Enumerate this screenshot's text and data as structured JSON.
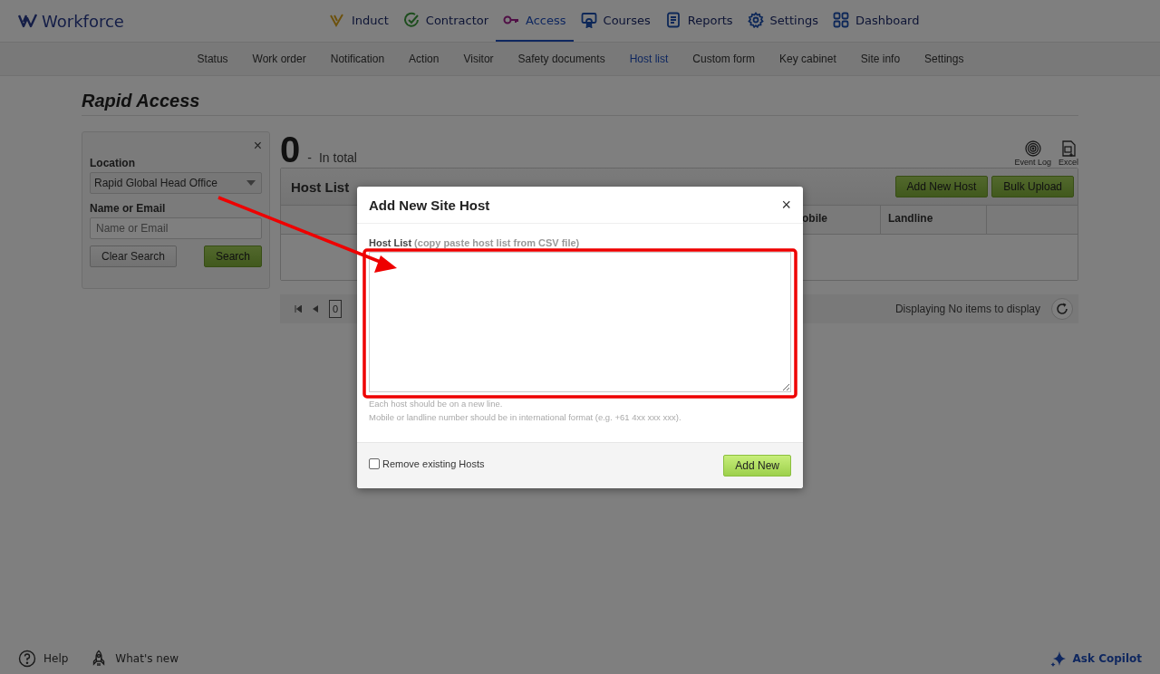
{
  "brand": "Workforce",
  "nav": [
    {
      "label": "Induct",
      "selected": false
    },
    {
      "label": "Contractor",
      "selected": false
    },
    {
      "label": "Access",
      "selected": true
    },
    {
      "label": "Courses",
      "selected": false
    },
    {
      "label": "Reports",
      "selected": false
    },
    {
      "label": "Settings",
      "selected": false
    },
    {
      "label": "Dashboard",
      "selected": false
    }
  ],
  "subnav": [
    {
      "label": "Status",
      "selected": false
    },
    {
      "label": "Work order",
      "selected": false
    },
    {
      "label": "Notification",
      "selected": false
    },
    {
      "label": "Action",
      "selected": false
    },
    {
      "label": "Visitor",
      "selected": false
    },
    {
      "label": "Safety documents",
      "selected": false
    },
    {
      "label": "Host list",
      "selected": true
    },
    {
      "label": "Custom form",
      "selected": false
    },
    {
      "label": "Key cabinet",
      "selected": false
    },
    {
      "label": "Site info",
      "selected": false
    },
    {
      "label": "Settings",
      "selected": false
    }
  ],
  "page_title": "Rapid Access",
  "filter": {
    "close": "×",
    "location_label": "Location",
    "location_value": "Rapid Global Head Office",
    "name_label": "Name or Email",
    "name_placeholder": "Name or Email",
    "clear_button": "Clear Search",
    "search_button": "Search"
  },
  "summary": {
    "count": "0",
    "dash": "-",
    "label": "In total"
  },
  "tools": [
    {
      "label": "Event Log"
    },
    {
      "label": "Excel"
    }
  ],
  "host_list": {
    "title": "Host List",
    "buttons": [
      "Add New Host",
      "Bulk Upload"
    ],
    "columns": [
      "obile",
      "Landline"
    ]
  },
  "pager": {
    "page": "0",
    "status": "Displaying No items to display"
  },
  "modal": {
    "title": "Add New Site Host",
    "close": "×",
    "field_label": "Host List",
    "field_hint": "(copy paste host list from CSV file)",
    "notes": [
      "Each host should be on a new line.",
      "Mobile or landline number should be in international format (e.g. +61 4xx xxx xxx)."
    ],
    "checkbox": {
      "label": "Remove existing Hosts",
      "checked": false
    },
    "submit": "Add New"
  },
  "footer": {
    "left": [
      {
        "label": "Help"
      },
      {
        "label": "What's new"
      }
    ],
    "copilot": "Ask Copilot"
  }
}
